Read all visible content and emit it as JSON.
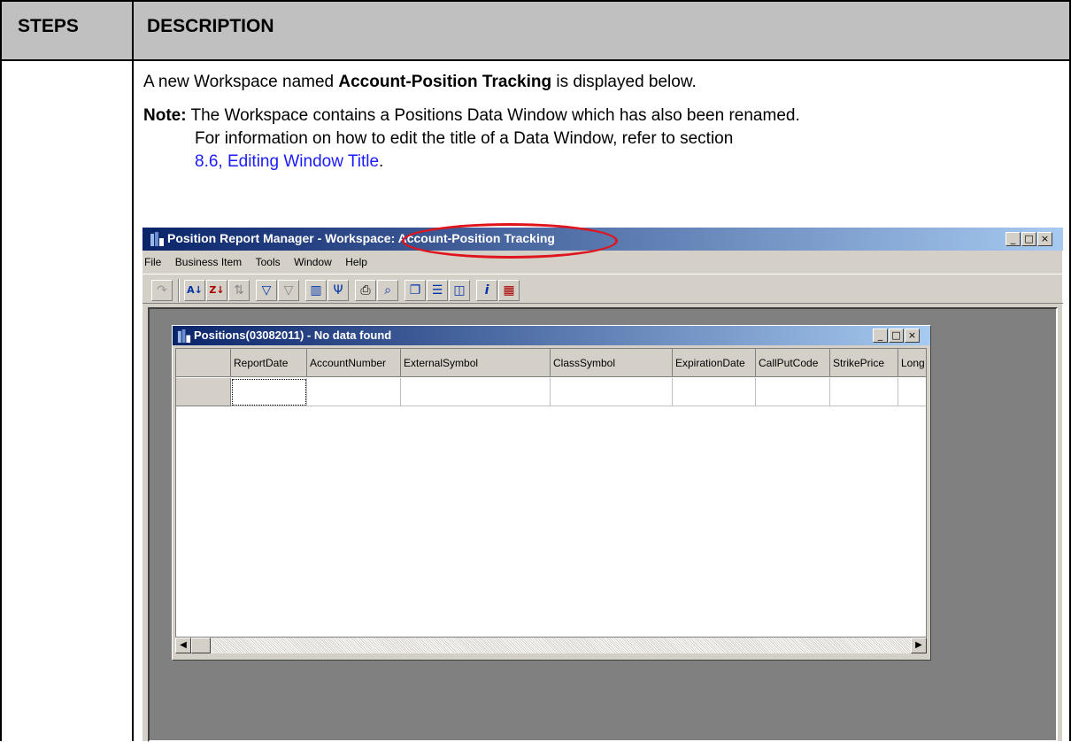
{
  "table": {
    "steps_header": "STEPS",
    "description_header": "DESCRIPTION"
  },
  "description": {
    "intro_prefix": "A new Workspace named ",
    "intro_bold": "Account-Position Tracking",
    "intro_suffix": " is displayed below.",
    "note_label": "Note:",
    "note_line1": "The Workspace contains a Positions Data Window which has also been renamed.",
    "note_line2": "For information on how to edit the title of a Data Window, refer to section",
    "note_link": "8.6,  Editing Window Title",
    "note_end": "."
  },
  "app": {
    "title": "Position Report Manager - Workspace: Account-Position Tracking",
    "menu": [
      "File",
      "Business Item",
      "Tools",
      "Window",
      "Help"
    ],
    "window_buttons": {
      "minimize": "_",
      "maximize": "□",
      "close": "×"
    },
    "annotation_color": "#e0141c"
  },
  "data_window": {
    "title": "Positions(03082011) - No data found",
    "columns": [
      "ReportDate",
      "AccountNumber",
      "ExternalSymbol",
      "ClassSymbol",
      "ExpirationDate",
      "CallPutCode",
      "StrikePrice",
      "Long"
    ]
  },
  "icons": {
    "toolbar": [
      "redo-icon",
      "sort-ascending-icon",
      "sort-descending-icon",
      "clear-sort-icon",
      "filter-icon",
      "clear-filter-icon",
      "columns-icon",
      "pivot-icon",
      "print-icon",
      "find-icon",
      "tile-cascade-icon",
      "tile-horizontal-icon",
      "tile-vertical-icon",
      "info-icon",
      "grid-settings-icon"
    ]
  }
}
